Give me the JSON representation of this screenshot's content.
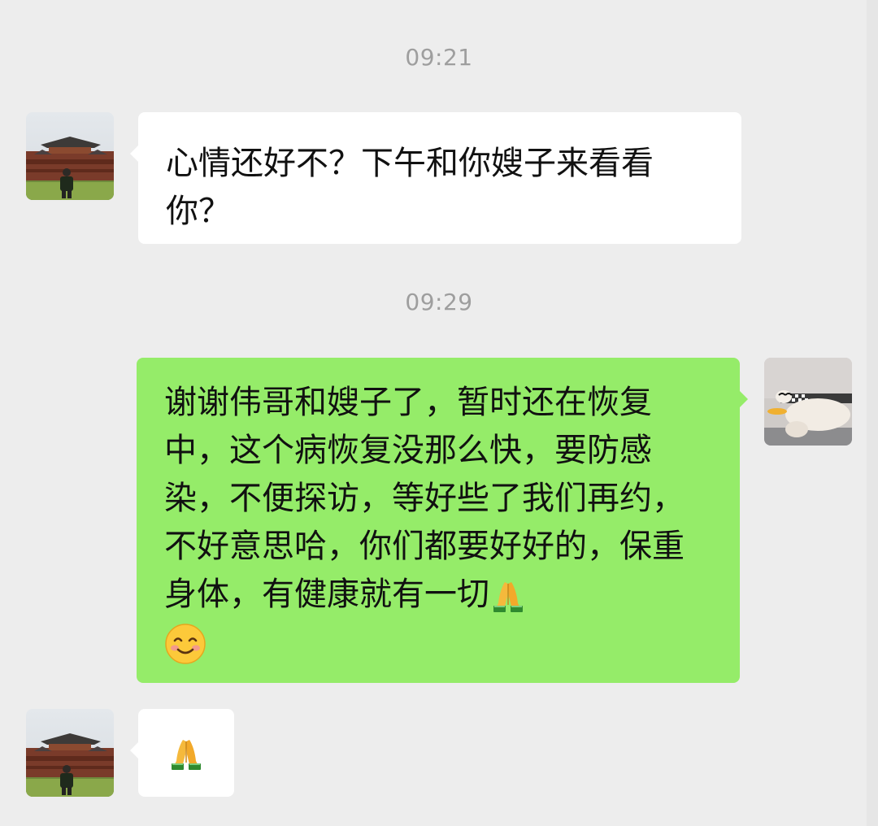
{
  "conversation": {
    "messages": [
      {
        "type": "time",
        "text": "09:21"
      },
      {
        "type": "incoming",
        "text": "心情还好不？下午和你嫂子来看看你？"
      },
      {
        "type": "time",
        "text": "09:29"
      },
      {
        "type": "outgoing",
        "text": "谢谢伟哥和嫂子了，暂时还在恢复中，这个病恢复没那么快，要防感染，不便探访，等好些了我们再约，不好意思哈，你们都要好好的，保重身体，有健康就有一切",
        "trailing_emojis": [
          "folded-hands-emoji",
          "smiling-face-emoji"
        ]
      },
      {
        "type": "incoming",
        "emoji": "folded-hands-emoji"
      }
    ]
  },
  "colors": {
    "background": "#ededed",
    "incoming_bubble": "#ffffff",
    "outgoing_bubble": "#95ec69",
    "timestamp": "#9e9e9e"
  },
  "icons": {
    "contact_avatar": "contact-avatar-photo-building",
    "self_avatar": "self-avatar-photo-plush-goose"
  }
}
